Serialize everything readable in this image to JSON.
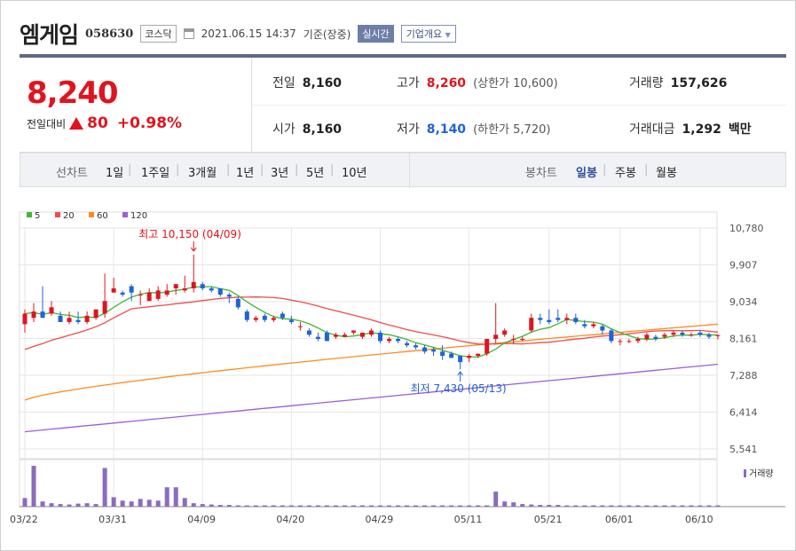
{
  "header": {
    "name": "엠게임",
    "code": "058630",
    "market": "코스닥",
    "datetime": "2021.06.15 14:37",
    "basis": "기준(장중)",
    "live": "실시간",
    "corp": "기업개요"
  },
  "quote": {
    "price": "8,240",
    "change_label": "전일대비",
    "change": "80",
    "change_pct": "+0.98%",
    "prev_label": "전일",
    "prev": "8,160",
    "high_label": "고가",
    "high": "8,260",
    "upper_limit": "(상한가 10,600)",
    "volume_label": "거래량",
    "volume": "157,626",
    "open_label": "시가",
    "open": "8,160",
    "low_label": "저가",
    "low": "8,140",
    "lower_limit": "(하한가 5,720)",
    "amount_label": "거래대금",
    "amount": "1,292",
    "amount_unit": "백만"
  },
  "tabs": {
    "line_label": "선차트",
    "line": [
      "1일",
      "1주일",
      "3개월",
      "1년",
      "3년",
      "5년",
      "10년"
    ],
    "candle_label": "봉차트",
    "candle": [
      "일봉",
      "주봉",
      "월봉"
    ],
    "candle_selected": 0
  },
  "chart_data": {
    "type": "candlestick",
    "legend": [
      {
        "name": "5",
        "color": "#3fb832"
      },
      {
        "name": "20",
        "color": "#ef4b4b"
      },
      {
        "name": "60",
        "color": "#ff8a1f"
      },
      {
        "name": "120",
        "color": "#9a5fd6"
      }
    ],
    "y_ticks": [
      "10,780",
      "9,907",
      "9,034",
      "8,161",
      "7,288",
      "6,414",
      "5,541"
    ],
    "ylim": [
      5541,
      10780
    ],
    "x_ticks": [
      "03/22",
      "03/31",
      "04/09",
      "04/20",
      "04/29",
      "05/11",
      "05/21",
      "06/01",
      "06/10"
    ],
    "high_note": "최고 10,150 (04/09)",
    "low_note": "최저 7,430 (05/13)",
    "volume_label": "거래량",
    "up_color": "#e0141e",
    "down_color": "#1f63d6",
    "candles": [
      [
        8500,
        8850,
        8300,
        8750
      ],
      [
        8650,
        9000,
        8550,
        8800
      ],
      [
        8800,
        9400,
        8650,
        8650
      ],
      [
        8750,
        9050,
        8700,
        8900
      ],
      [
        8700,
        8800,
        8550,
        8550
      ],
      [
        8550,
        8800,
        8500,
        8650
      ],
      [
        8600,
        8800,
        8500,
        8550
      ],
      [
        8550,
        8800,
        8500,
        8700
      ],
      [
        8650,
        8850,
        8600,
        8850
      ],
      [
        8750,
        9700,
        8650,
        9050
      ],
      [
        9250,
        9600,
        9250,
        9350
      ],
      [
        9250,
        9300,
        9150,
        9200
      ],
      [
        9400,
        9450,
        9050,
        9250
      ],
      [
        9200,
        9300,
        8950,
        9200
      ],
      [
        9050,
        9350,
        9050,
        9250
      ],
      [
        9100,
        9400,
        9050,
        9300
      ],
      [
        9200,
        9450,
        9150,
        9300
      ],
      [
        9350,
        9450,
        9200,
        9450
      ],
      [
        9300,
        9650,
        9250,
        9350
      ],
      [
        9350,
        10150,
        9250,
        9500
      ],
      [
        9450,
        9500,
        9300,
        9350
      ],
      [
        9350,
        9400,
        9250,
        9300
      ],
      [
        9350,
        9350,
        9150,
        9200
      ],
      [
        9200,
        9250,
        9000,
        9150
      ],
      [
        9100,
        9150,
        8850,
        8900
      ],
      [
        8800,
        8850,
        8550,
        8600
      ],
      [
        8600,
        8700,
        8550,
        8650
      ],
      [
        8700,
        8750,
        8550,
        8600
      ],
      [
        8600,
        8700,
        8550,
        8650
      ],
      [
        8750,
        8800,
        8600,
        8650
      ],
      [
        8600,
        8700,
        8500,
        8550
      ],
      [
        8450,
        8550,
        8350,
        8450
      ],
      [
        8350,
        8400,
        8200,
        8250
      ],
      [
        8200,
        8300,
        8100,
        8150
      ],
      [
        8300,
        8350,
        8100,
        8100
      ],
      [
        8200,
        8300,
        8150,
        8250
      ],
      [
        8200,
        8300,
        8200,
        8250
      ],
      [
        8300,
        8350,
        8250,
        8350
      ],
      [
        8200,
        8300,
        8150,
        8300
      ],
      [
        8250,
        8400,
        8200,
        8350
      ],
      [
        8300,
        8350,
        8050,
        8100
      ],
      [
        8100,
        8200,
        8050,
        8150
      ],
      [
        8150,
        8200,
        8050,
        8100
      ],
      [
        8050,
        8100,
        7950,
        8000
      ],
      [
        8000,
        8050,
        7900,
        7950
      ],
      [
        7950,
        8000,
        7800,
        7850
      ],
      [
        7900,
        7950,
        7750,
        7850
      ],
      [
        7850,
        8000,
        7650,
        7750
      ],
      [
        7800,
        7850,
        7700,
        7700
      ],
      [
        7750,
        7750,
        7430,
        7600
      ],
      [
        7700,
        7800,
        7600,
        7750
      ],
      [
        7750,
        7800,
        7700,
        7800
      ],
      [
        7800,
        8150,
        7750,
        8150
      ],
      [
        8150,
        9000,
        8050,
        8250
      ],
      [
        8250,
        8400,
        8200,
        8350
      ],
      [
        8150,
        8250,
        8050,
        8150
      ],
      [
        8150,
        8200,
        8100,
        8150
      ],
      [
        8350,
        8750,
        8300,
        8650
      ],
      [
        8650,
        8750,
        8500,
        8600
      ],
      [
        8600,
        8850,
        8500,
        8550
      ],
      [
        8650,
        8850,
        8550,
        8600
      ],
      [
        8600,
        8750,
        8500,
        8650
      ],
      [
        8650,
        8750,
        8500,
        8550
      ],
      [
        8500,
        8600,
        8400,
        8450
      ],
      [
        8450,
        8550,
        8400,
        8500
      ],
      [
        8450,
        8500,
        8250,
        8350
      ],
      [
        8350,
        8400,
        8050,
        8100
      ],
      [
        8100,
        8150,
        8000,
        8100
      ],
      [
        8100,
        8150,
        8050,
        8100
      ],
      [
        8100,
        8200,
        8050,
        8150
      ],
      [
        8150,
        8300,
        8100,
        8250
      ],
      [
        8200,
        8250,
        8100,
        8150
      ],
      [
        8200,
        8300,
        8150,
        8250
      ],
      [
        8250,
        8350,
        8200,
        8300
      ],
      [
        8300,
        8350,
        8200,
        8250
      ],
      [
        8250,
        8300,
        8200,
        8250
      ],
      [
        8300,
        8350,
        8200,
        8250
      ],
      [
        8250,
        8300,
        8150,
        8200
      ],
      [
        8240,
        8260,
        8140,
        8240
      ]
    ],
    "volumes": [
      20,
      95,
      12,
      8,
      6,
      5,
      7,
      8,
      6,
      90,
      22,
      14,
      12,
      18,
      16,
      14,
      45,
      45,
      20,
      8,
      6,
      5,
      4,
      4,
      3,
      3,
      3,
      3,
      3,
      3,
      3,
      3,
      3,
      3,
      3,
      3,
      3,
      3,
      3,
      3,
      3,
      3,
      3,
      3,
      3,
      3,
      3,
      3,
      3,
      3,
      3,
      3,
      3,
      35,
      12,
      10,
      6,
      5,
      4,
      4,
      4,
      3,
      3,
      3,
      3,
      3,
      3,
      3,
      3,
      3,
      3,
      3,
      3,
      3,
      3,
      3,
      3,
      3,
      3
    ]
  }
}
